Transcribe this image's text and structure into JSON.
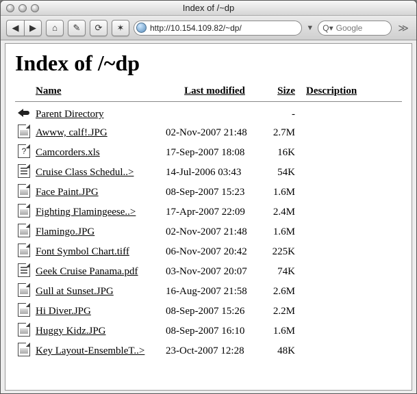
{
  "window": {
    "title": "Index of /~dp"
  },
  "toolbar": {
    "url": "http://10.154.109.82/~dp/",
    "search_placeholder": "Google"
  },
  "page": {
    "heading": "Index of /~dp",
    "columns": {
      "name": "Name",
      "modified": "Last modified",
      "size": "Size",
      "description": "Description"
    },
    "parent": {
      "label": "Parent Directory",
      "size": "-"
    },
    "entries": [
      {
        "icon": "img",
        "name": "Awww, calf!.JPG",
        "modified": "02-Nov-2007 21:48",
        "size": "2.7M"
      },
      {
        "icon": "unk",
        "name": "Camcorders.xls",
        "modified": "17-Sep-2007 18:08",
        "size": "16K"
      },
      {
        "icon": "txt",
        "name": "Cruise Class Schedul..>",
        "modified": "14-Jul-2006 03:43",
        "size": "54K"
      },
      {
        "icon": "img",
        "name": "Face Paint.JPG",
        "modified": "08-Sep-2007 15:23",
        "size": "1.6M"
      },
      {
        "icon": "img",
        "name": "Fighting Flamingeese..>",
        "modified": "17-Apr-2007 22:09",
        "size": "2.4M"
      },
      {
        "icon": "img",
        "name": "Flamingo.JPG",
        "modified": "02-Nov-2007 21:48",
        "size": "1.6M"
      },
      {
        "icon": "img",
        "name": "Font Symbol Chart.tiff",
        "modified": "06-Nov-2007 20:42",
        "size": "225K"
      },
      {
        "icon": "pdf",
        "name": "Geek Cruise Panama.pdf",
        "modified": "03-Nov-2007 20:07",
        "size": "74K"
      },
      {
        "icon": "img",
        "name": "Gull at Sunset.JPG",
        "modified": "16-Aug-2007 21:58",
        "size": "2.6M"
      },
      {
        "icon": "img",
        "name": "Hi Diver.JPG",
        "modified": "08-Sep-2007 15:26",
        "size": "2.2M"
      },
      {
        "icon": "img",
        "name": "Huggy Kidz.JPG",
        "modified": "08-Sep-2007 16:10",
        "size": "1.6M"
      },
      {
        "icon": "img",
        "name": "Key Layout-EnsembleT..>",
        "modified": "23-Oct-2007 12:28",
        "size": "48K"
      }
    ]
  }
}
